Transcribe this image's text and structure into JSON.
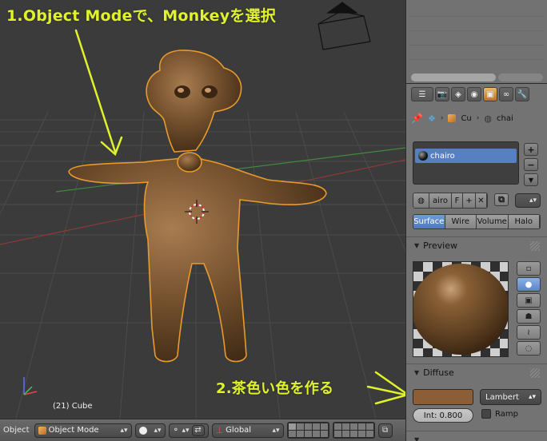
{
  "annotations": {
    "step1": "1.Object Modeで、Monkeyを選択",
    "step2": "2.茶色い色を作る"
  },
  "viewport": {
    "object_info": "(21) Cube",
    "colors": {
      "background": "#3b3b3b",
      "grid": "#4a4a4a",
      "model": "#7a5532",
      "selection_outline": "#e89a2c",
      "annotation": "#dff22a"
    }
  },
  "header3d": {
    "label": "Object",
    "mode": "Object Mode",
    "orientation": "Global"
  },
  "properties": {
    "context_icons": [
      "render-icon",
      "scene-icon",
      "world-icon",
      "object-icon",
      "constraint-icon",
      "modifier-icon"
    ],
    "breadcrumb": [
      "Cu",
      "chai"
    ],
    "material_slot": "chairo",
    "material_name": "airo",
    "fake_user": "F",
    "tabs": [
      {
        "label": "Surface",
        "active": true
      },
      {
        "label": "Wire",
        "active": false
      },
      {
        "label": "Volume",
        "active": false
      },
      {
        "label": "Halo",
        "active": false
      }
    ],
    "preview_title": "Preview",
    "diffuse_title": "Diffuse",
    "diffuse_color": "#8b5e37",
    "diffuse_shader": "Lambert",
    "intensity": "Int: 0.800",
    "ramp_label": "Ramp"
  }
}
